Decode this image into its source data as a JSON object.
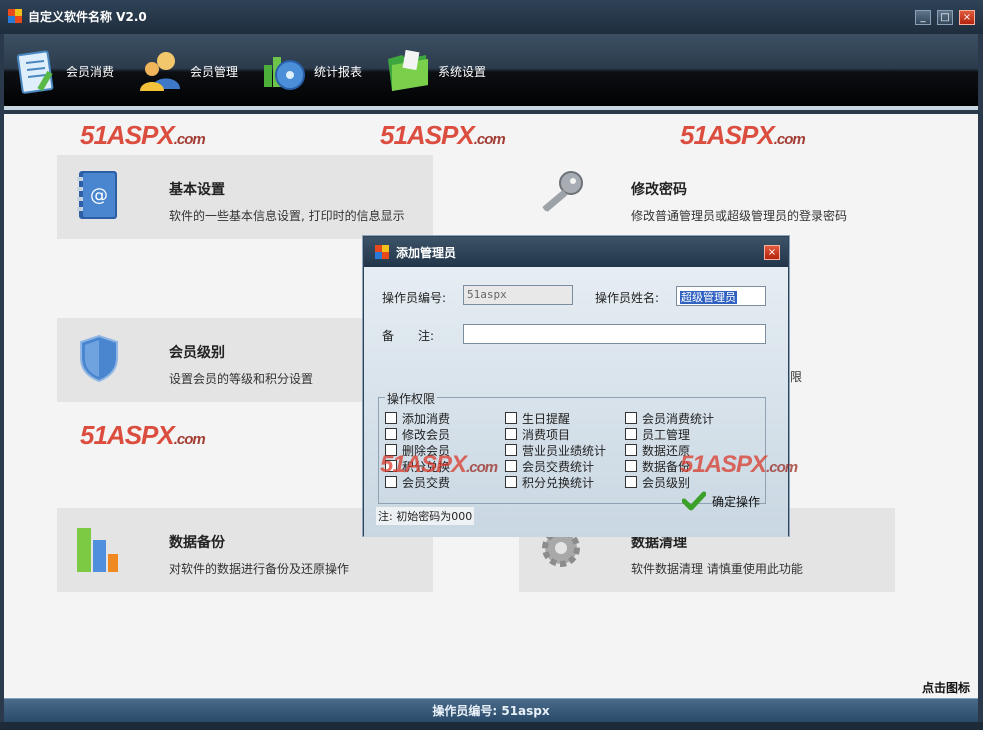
{
  "window": {
    "title": "自定义软件名称 V2.0",
    "minimize_label": "_",
    "maximize_label": "□",
    "close_label": "×"
  },
  "toolbar": {
    "items": [
      {
        "label": "会员消费",
        "icon": "notepad-icon"
      },
      {
        "label": "会员管理",
        "icon": "users-icon"
      },
      {
        "label": "统计报表",
        "icon": "chart-disc-icon"
      },
      {
        "label": "系统设置",
        "icon": "folder-icon"
      }
    ]
  },
  "watermarks": {
    "text_main": "51ASPX",
    "text_suffix": ".com"
  },
  "cards": [
    {
      "title": "基本设置",
      "desc": "软件的一些基本信息设置, 打印时的信息显示",
      "icon": "address-book-icon"
    },
    {
      "title": "修改密码",
      "desc": "修改普通管理员或超级管理员的登录密码",
      "icon": "key-icon"
    },
    {
      "title": "会员级别",
      "desc": "设置会员的等级和积分设置",
      "icon": "shield-icon"
    },
    {
      "title": "数据备份",
      "desc": "对软件的数据进行备份及还原操作",
      "icon": "bar-chart-icon"
    },
    {
      "title": "数据清理",
      "desc": "软件数据清理 请慎重使用此功能",
      "icon": "gear-icon"
    }
  ],
  "partial_text_behind_dialog": "限",
  "hint": "点击图标",
  "status_bar": {
    "text": "操作员编号: 51aspx"
  },
  "dialog": {
    "title": "添加管理员",
    "close_label": "×",
    "operator_id_label": "操作员编号:",
    "operator_id_value": "51aspx",
    "operator_name_label": "操作员姓名:",
    "operator_name_value": "超级管理员",
    "remark_label": "备　　注:",
    "remark_value": "",
    "permissions_label": "操作权限",
    "permissions": [
      [
        "添加消费",
        "生日提醒",
        "会员消费统计"
      ],
      [
        "修改会员",
        "消费项目",
        "员工管理"
      ],
      [
        "删除会员",
        "营业员业绩统计",
        "数据还原"
      ],
      [
        "积分兑换",
        "会员交费统计",
        "数据备份"
      ],
      [
        "会员交费",
        "积分兑换统计",
        "会员级别"
      ]
    ],
    "note": "注: 初始密码为000",
    "ok_label": "确定操作"
  }
}
